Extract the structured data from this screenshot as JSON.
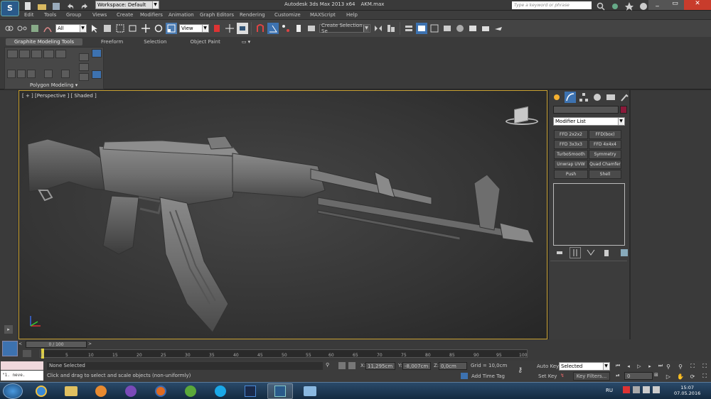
{
  "titlebar": {
    "workspace": "Workspace: Default",
    "title": "Autodesk 3ds Max 2013 x64",
    "file": "AKM.max",
    "search_placeholder": "Type a keyword or phrase"
  },
  "menu": [
    "Edit",
    "Tools",
    "Group",
    "Views",
    "Create",
    "Modifiers",
    "Animation",
    "Graph Editors",
    "Rendering",
    "Customize",
    "MAXScript",
    "Help"
  ],
  "toolbar": {
    "selection_filter": "All",
    "ref_coord": "View",
    "named_selection": "Create Selection Se"
  },
  "ribbon": {
    "tabs": [
      "Graphite Modeling Tools",
      "Freeform",
      "Selection",
      "Object Paint"
    ],
    "panel_label": "Polygon Modeling"
  },
  "viewport": {
    "label": "[ + ] [Perspective ] [ Shaded ]",
    "colors": {
      "frame": "#c8a030",
      "bg_center": "#3c3c3c"
    }
  },
  "command_panel": {
    "object_name": "",
    "modifier_list": "Modifier List",
    "modifier_buttons": [
      [
        "FFD 2x2x2",
        "FFD(box)"
      ],
      [
        "FFD 3x3x3",
        "FFD 4x4x4"
      ],
      [
        "TurboSmooth",
        "Symmetry"
      ],
      [
        "Unwrap UVW",
        "Quad Chamfer"
      ],
      [
        "Push",
        "Shell"
      ]
    ]
  },
  "timeline": {
    "slider": "0 / 100",
    "ticks": [
      "0",
      "5",
      "10",
      "15",
      "20",
      "25",
      "30",
      "35",
      "40",
      "45",
      "50",
      "55",
      "60",
      "65",
      "70",
      "75",
      "80",
      "85",
      "90",
      "95",
      "100"
    ]
  },
  "status": {
    "listener": "\"1.   neve.",
    "selection": "None Selected",
    "prompt": "Click and drag to select and scale objects (non-uniformly)",
    "x_label": "X:",
    "x": "11,295cm",
    "y_label": "Y:",
    "y": "-8,007cm",
    "z_label": "Z:",
    "z": "0,0cm",
    "grid": "Grid = 10,0cm",
    "add_time_tag": "Add Time Tag",
    "auto_key": "Auto Key",
    "set_key": "Set Key",
    "key_mode": "Selected",
    "key_filters": "Key Filters...",
    "frame": "0"
  },
  "taskbar": {
    "lang": "RU",
    "time": "15:07",
    "date": "07.05.2016"
  }
}
